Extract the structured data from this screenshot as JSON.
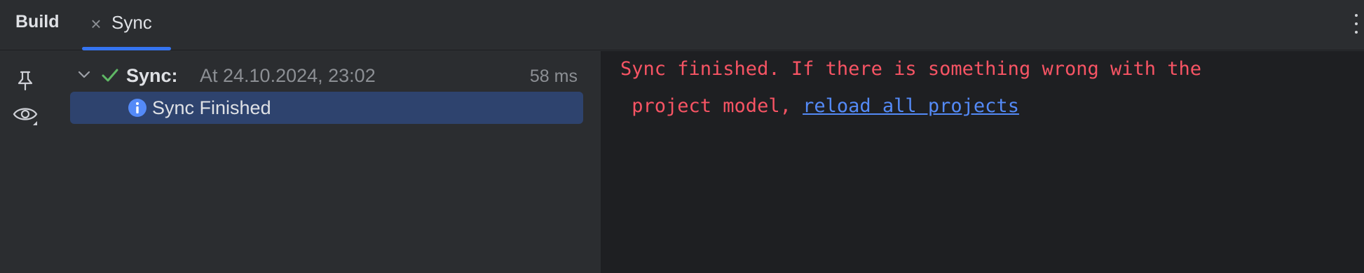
{
  "panel": {
    "title": "Build"
  },
  "tabs": [
    {
      "label": "Sync",
      "active": true,
      "close_icon": "close-icon"
    }
  ],
  "toolbar": {
    "more_icon": "vertical-ellipsis-icon",
    "tools": [
      {
        "icon": "pin-icon"
      },
      {
        "icon": "eye-icon"
      }
    ]
  },
  "tree": {
    "root": {
      "label": "Sync:",
      "timestamp": "At 24.10.2024, 23:02",
      "duration": "58 ms",
      "status_icon": "check-icon",
      "expanded": true
    },
    "children": [
      {
        "label": "Sync Finished",
        "icon": "info-icon",
        "selected": true
      }
    ]
  },
  "console": {
    "line1": "Sync finished. If there is something wrong with the",
    "line2_prefix": " project model, ",
    "link_text": "reload all projects"
  },
  "colors": {
    "accent": "#3574f0",
    "success": "#5fb865",
    "error_text": "#f75464",
    "link": "#548af7",
    "selection": "#2e436e"
  }
}
